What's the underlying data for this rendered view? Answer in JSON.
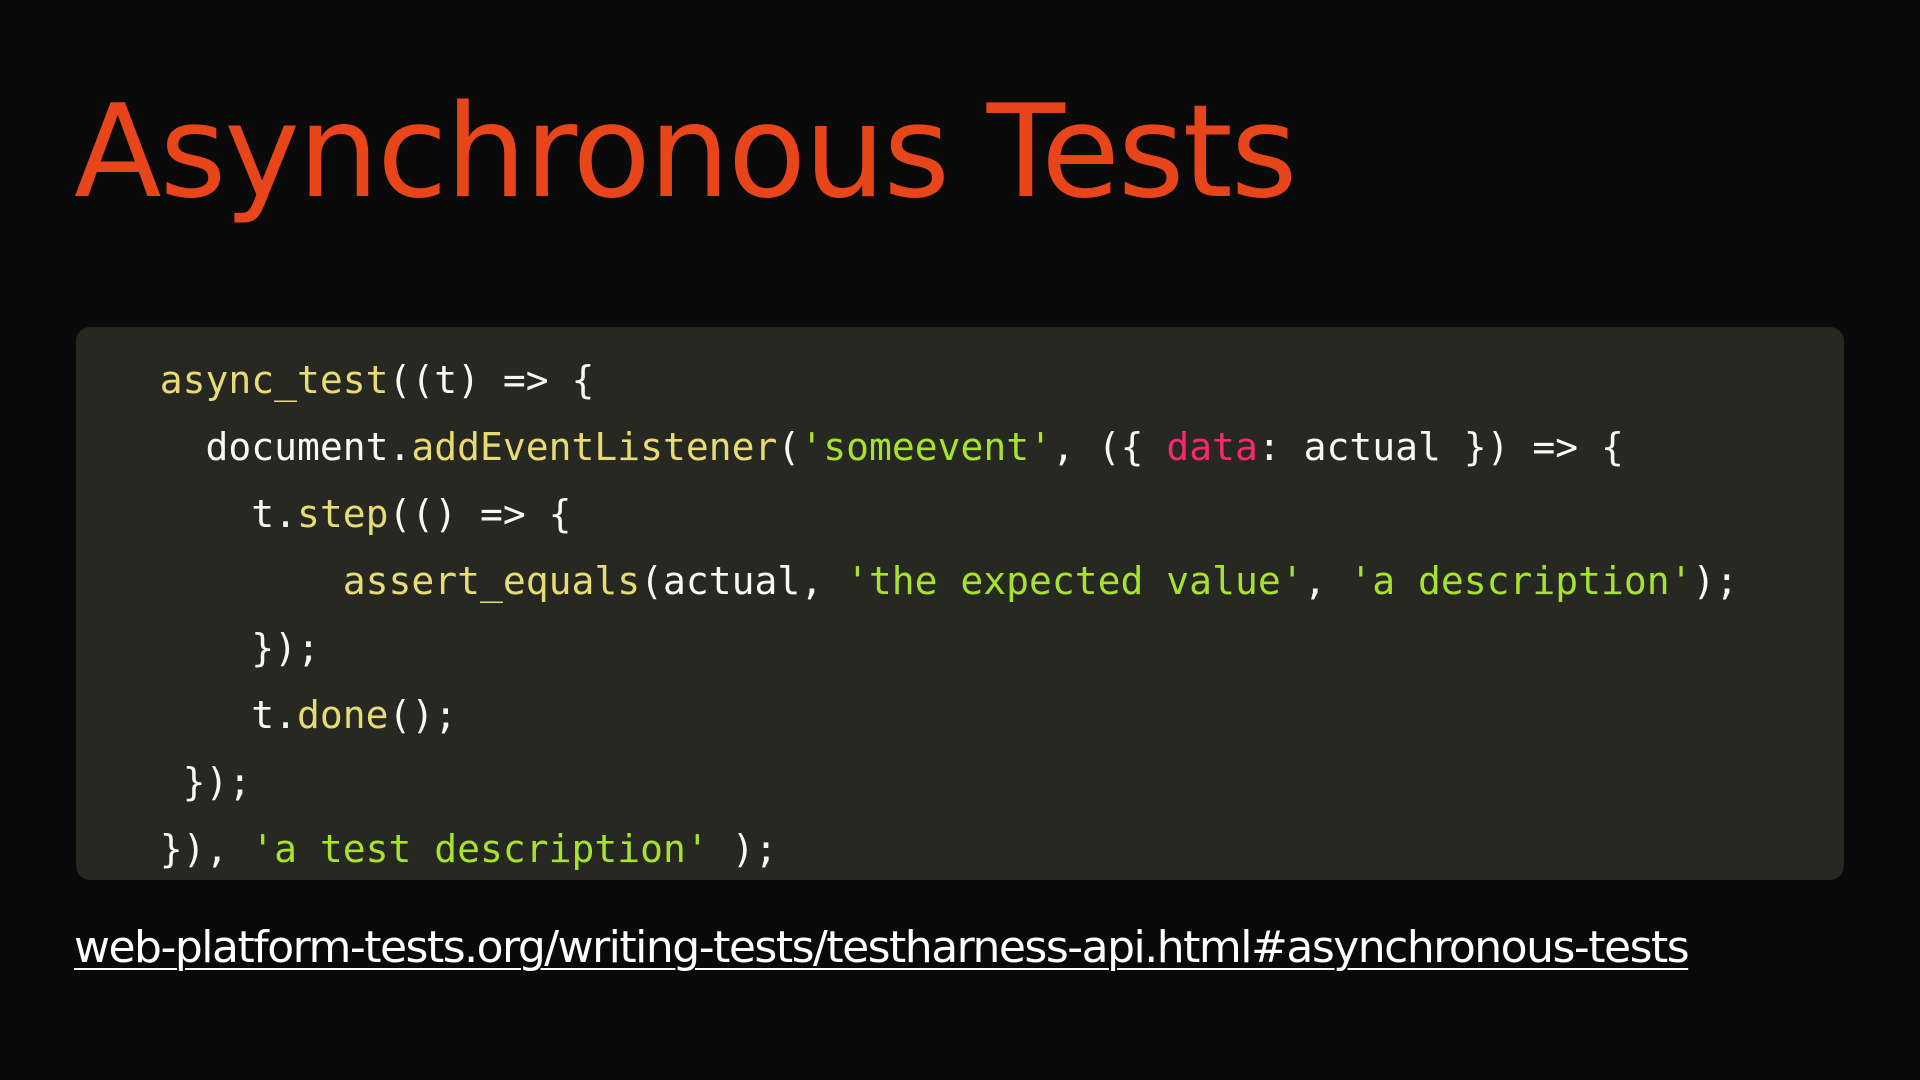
{
  "slide": {
    "title": "Asynchronous Tests",
    "link_text": "web-platform-tests.org/writing-tests/testharness-api.html#asynchronous-tests"
  },
  "colors": {
    "background": "#0a0a0a",
    "title": "#e8461a",
    "code_background": "#272822",
    "code_plain": "#f8f8f2",
    "code_function": "#e6db74",
    "code_string": "#a6e22e",
    "code_keyword": "#f92672",
    "link": "#ffffff"
  },
  "code": {
    "lines": [
      {
        "indent": 2,
        "tokens": [
          {
            "type": "fn",
            "text": "async_test"
          },
          {
            "type": "plain",
            "text": "((t) => {"
          }
        ]
      },
      {
        "indent": 4,
        "tokens": [
          {
            "type": "plain",
            "text": "document."
          },
          {
            "type": "fn",
            "text": "addEventListener"
          },
          {
            "type": "plain",
            "text": "("
          },
          {
            "type": "str",
            "text": "'someevent'"
          },
          {
            "type": "plain",
            "text": ", ({ "
          },
          {
            "type": "key",
            "text": "data"
          },
          {
            "type": "plain",
            "text": ": actual }) => {"
          }
        ]
      },
      {
        "indent": 6,
        "tokens": [
          {
            "type": "plain",
            "text": "t."
          },
          {
            "type": "fn",
            "text": "step"
          },
          {
            "type": "plain",
            "text": "(() => {"
          }
        ]
      },
      {
        "indent": 10,
        "tokens": [
          {
            "type": "fn",
            "text": "assert_equals"
          },
          {
            "type": "plain",
            "text": "(actual, "
          },
          {
            "type": "str",
            "text": "'the expected value'"
          },
          {
            "type": "plain",
            "text": ", "
          },
          {
            "type": "str",
            "text": "'a description'"
          },
          {
            "type": "plain",
            "text": ");"
          }
        ]
      },
      {
        "indent": 6,
        "tokens": [
          {
            "type": "plain",
            "text": "});"
          }
        ]
      },
      {
        "indent": 6,
        "tokens": [
          {
            "type": "plain",
            "text": "t."
          },
          {
            "type": "fn",
            "text": "done"
          },
          {
            "type": "plain",
            "text": "();"
          }
        ]
      },
      {
        "indent": 3,
        "tokens": [
          {
            "type": "plain",
            "text": "});"
          }
        ]
      },
      {
        "indent": 2,
        "tokens": [
          {
            "type": "plain",
            "text": "}), "
          },
          {
            "type": "str",
            "text": "'a test description'"
          },
          {
            "type": "plain",
            "text": " );"
          }
        ]
      }
    ]
  }
}
